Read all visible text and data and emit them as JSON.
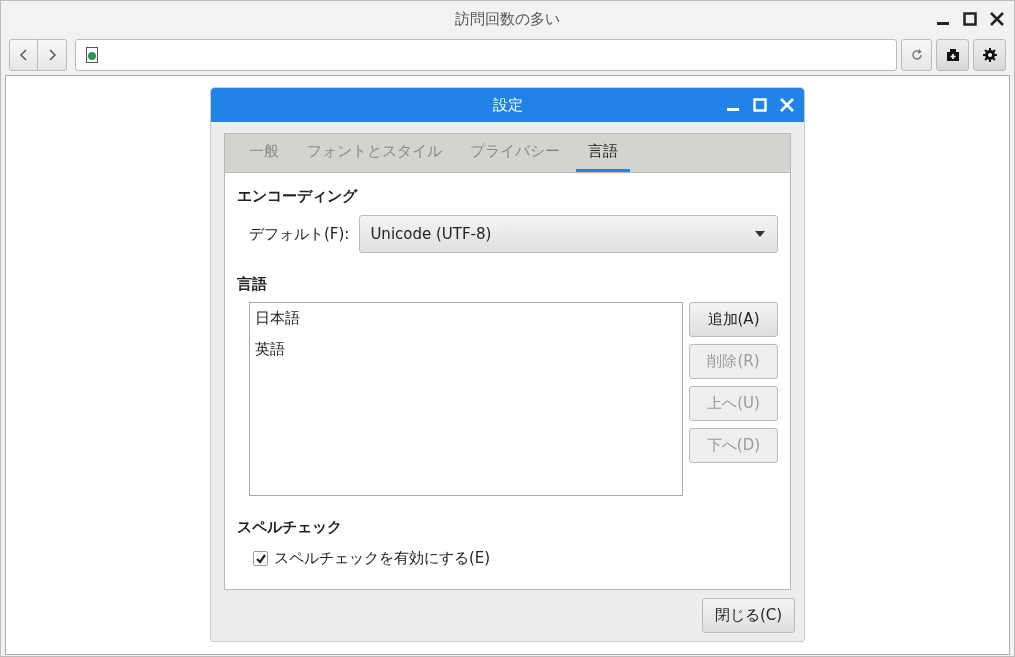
{
  "window": {
    "title": "訪問回数の多い"
  },
  "dialog": {
    "title": "設定",
    "tabs": [
      {
        "label": "一般",
        "selected": false
      },
      {
        "label": "フォントとスタイル",
        "selected": false
      },
      {
        "label": "プライバシー",
        "selected": false
      },
      {
        "label": "言語",
        "selected": true
      }
    ],
    "encoding": {
      "heading": "エンコーディング",
      "label": "デフォルト(F):",
      "value": "Unicode (UTF-8)"
    },
    "languages": {
      "heading": "言語",
      "items": [
        {
          "label": "日本語",
          "selected": false
        },
        {
          "label": "英語",
          "selected": false
        }
      ],
      "buttons": [
        {
          "label": "追加(A)",
          "disabled": false
        },
        {
          "label": "削除(R)",
          "disabled": true
        },
        {
          "label": "上へ(U)",
          "disabled": true
        },
        {
          "label": "下へ(D)",
          "disabled": true
        }
      ]
    },
    "spellcheck": {
      "heading": "スペルチェック",
      "label": "スペルチェックを有効にする(E)",
      "checked": true
    },
    "close_button": "閉じる(C)"
  }
}
